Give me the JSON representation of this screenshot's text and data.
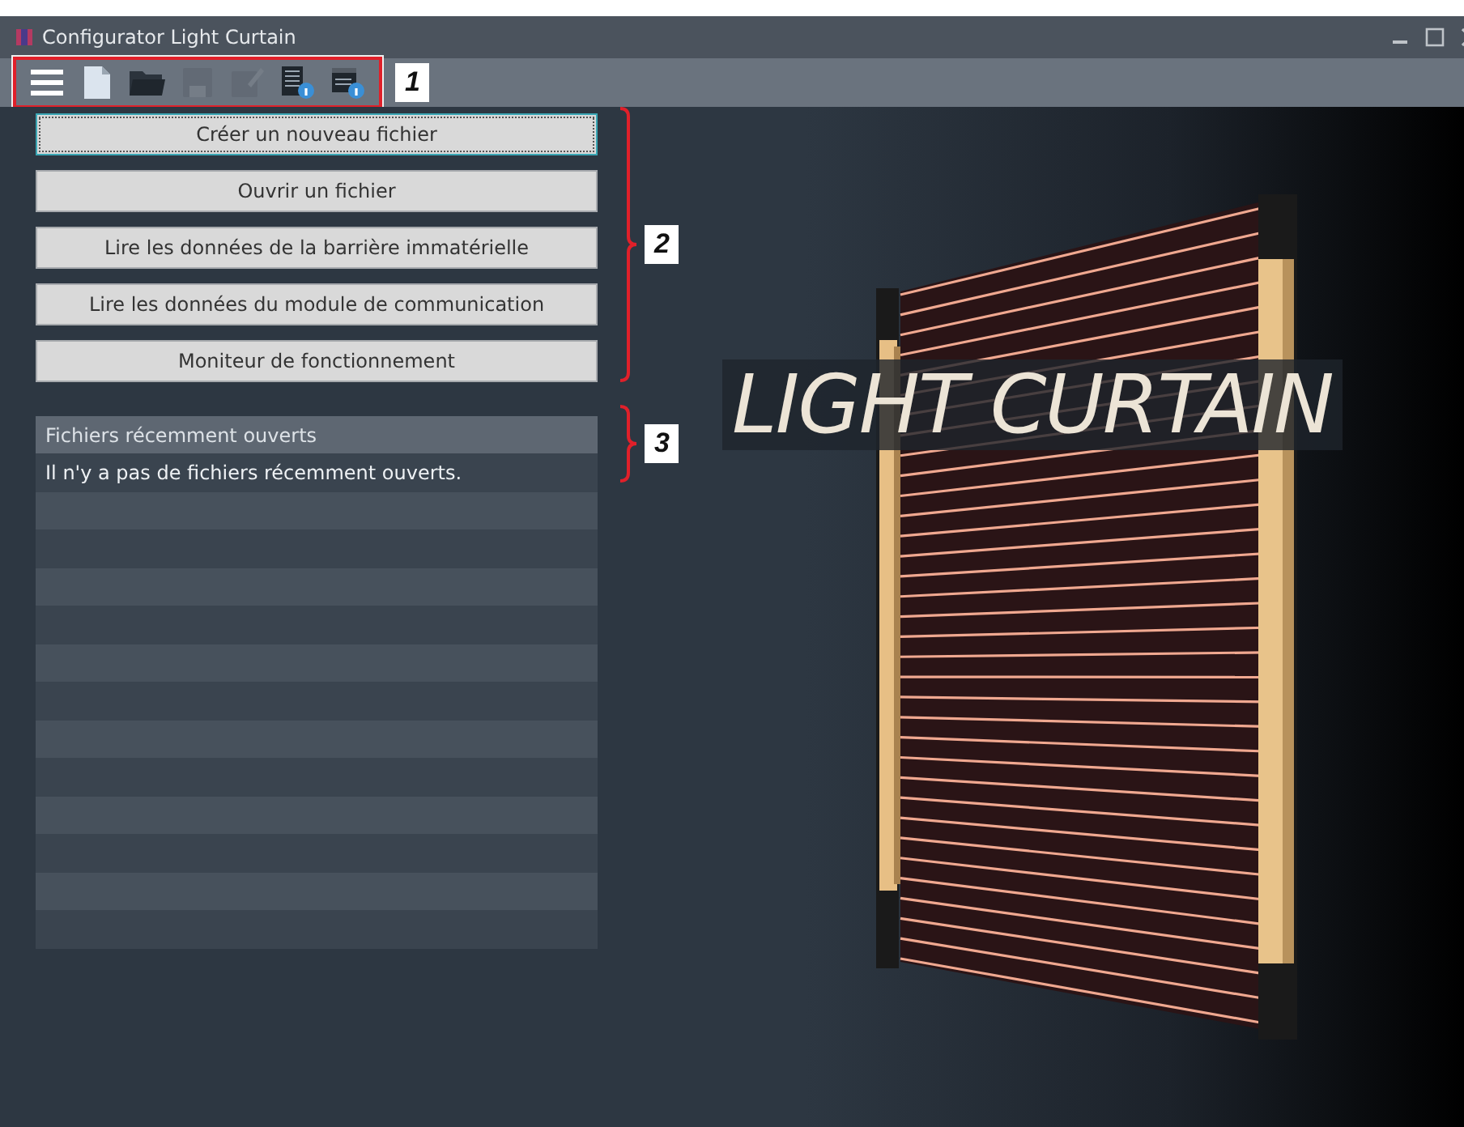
{
  "window": {
    "title": "Configurator Light Curtain"
  },
  "toolbar": {
    "callout": "1",
    "tools": [
      {
        "kind": "menu",
        "disabled": false
      },
      {
        "kind": "new",
        "disabled": false
      },
      {
        "kind": "open",
        "disabled": false
      },
      {
        "kind": "save",
        "disabled": true
      },
      {
        "kind": "save-as",
        "disabled": true
      },
      {
        "kind": "curtain-info",
        "disabled": false
      },
      {
        "kind": "module-info",
        "disabled": false
      }
    ]
  },
  "actions": {
    "callout": "2",
    "buttons": [
      {
        "label": "Créer un nouveau fichier",
        "selected": true
      },
      {
        "label": "Ouvrir un fichier",
        "selected": false
      },
      {
        "label": "Lire les données de la barrière immatérielle",
        "selected": false
      },
      {
        "label": "Lire les données du module de communication",
        "selected": false
      },
      {
        "label": "Moniteur de fonctionnement",
        "selected": false
      }
    ]
  },
  "recent": {
    "callout": "3",
    "title": "Fichiers récemment ouverts",
    "message": "Il n'y a pas de fichiers récemment ouverts."
  },
  "banner": {
    "title": "LIGHT CURTAIN"
  }
}
